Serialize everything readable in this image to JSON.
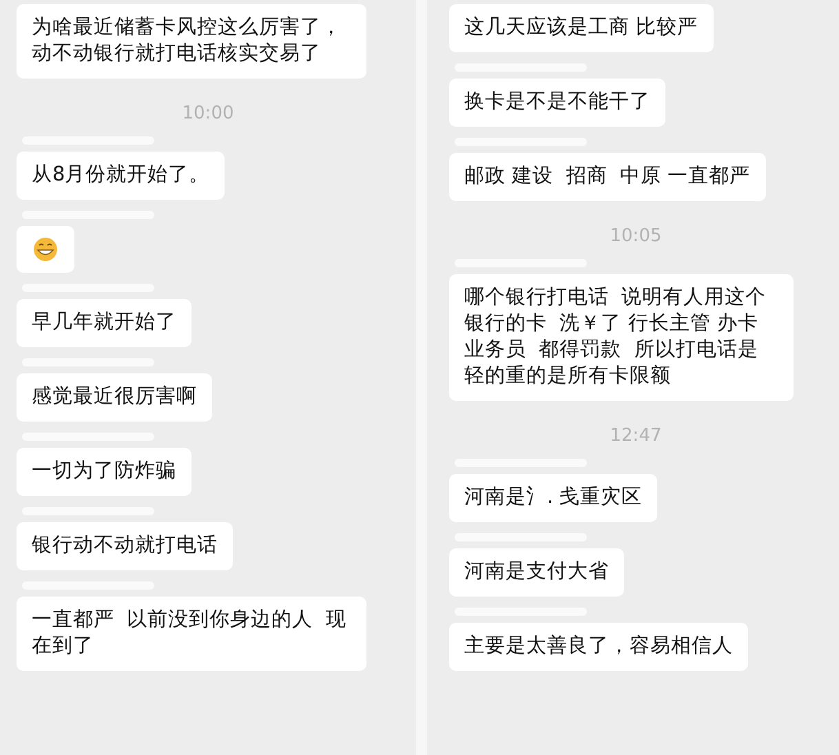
{
  "panels": [
    {
      "items": [
        {
          "kind": "message",
          "sender_hidden": false,
          "text": "为啥最近储蓄卡风控这么厉害了，动不动银行就打电话核实交易了"
        },
        {
          "kind": "time",
          "text": "10:00"
        },
        {
          "kind": "message",
          "sender_hidden": true,
          "text": "从8月份就开始了。"
        },
        {
          "kind": "emoji",
          "sender_hidden": true
        },
        {
          "kind": "message",
          "sender_hidden": true,
          "text": "早几年就开始了"
        },
        {
          "kind": "message",
          "sender_hidden": true,
          "text": "感觉最近很厉害啊"
        },
        {
          "kind": "message",
          "sender_hidden": true,
          "text": "一切为了防炸骗"
        },
        {
          "kind": "message",
          "sender_hidden": true,
          "text": "银行动不动就打电话"
        },
        {
          "kind": "message",
          "sender_hidden": true,
          "text": "一直都严  以前没到你身边的人  现在到了"
        }
      ]
    },
    {
      "items": [
        {
          "kind": "message",
          "sender_hidden": false,
          "text": "这几天应该是工商 比较严"
        },
        {
          "kind": "message",
          "sender_hidden": true,
          "text": "换卡是不是不能干了"
        },
        {
          "kind": "message",
          "sender_hidden": true,
          "text": "邮政 建设  招商  中原 一直都严"
        },
        {
          "kind": "time",
          "text": "10:05"
        },
        {
          "kind": "message",
          "sender_hidden": true,
          "text": "哪个银行打电话  说明有人用这个银行的卡  洗￥了 行长主管 办卡业务员  都得罚款  所以打电话是轻的重的是所有卡限额"
        },
        {
          "kind": "time",
          "text": "12:47"
        },
        {
          "kind": "message",
          "sender_hidden": true,
          "text": "河南是氵. 戋重灾区"
        },
        {
          "kind": "message",
          "sender_hidden": true,
          "text": "河南是支付大省"
        },
        {
          "kind": "message",
          "sender_hidden": true,
          "text": "主要是太善良了，容易相信人"
        }
      ]
    }
  ]
}
